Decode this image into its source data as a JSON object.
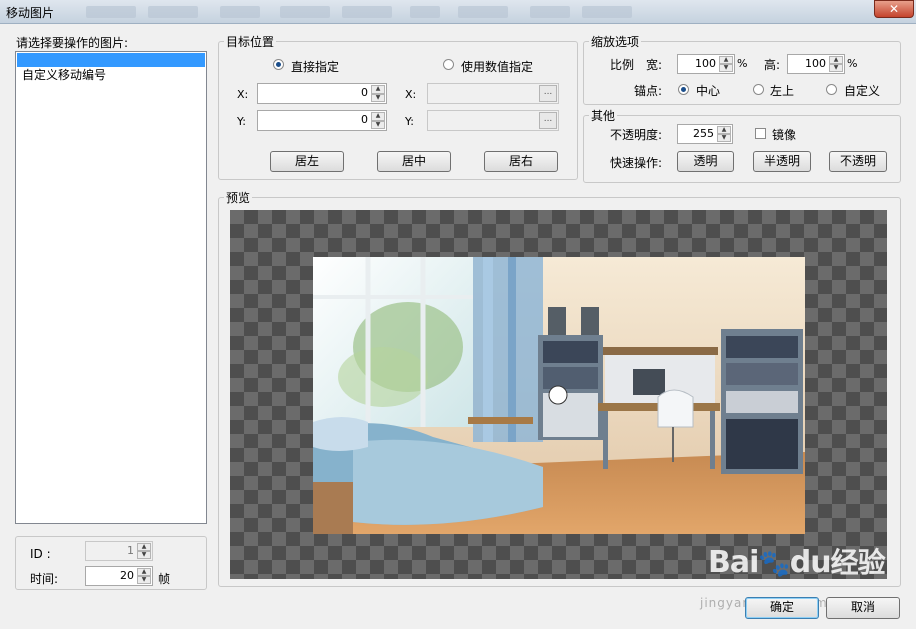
{
  "window": {
    "title": "移动图片",
    "close_glyph": "✕"
  },
  "picture_list": {
    "label": "请选择要操作的图片:",
    "items": [
      "",
      "自定义移动编号"
    ]
  },
  "id_time": {
    "id_label": "ID :",
    "id_value": "1",
    "time_label": "时间:",
    "time_value": "20",
    "time_unit": "帧"
  },
  "target": {
    "label": "目标位置",
    "direct_label": "直接指定",
    "numeric_label": "使用数值指定",
    "x_label": "X:",
    "y_label": "Y:",
    "x_value": "0",
    "y_value": "0",
    "browse_label": "...",
    "btn_left": "居左",
    "btn_center": "居中",
    "btn_right": "居右"
  },
  "scale": {
    "label": "缩放选项",
    "ratio_label": "比例",
    "width_label": "宽:",
    "width_value": "100",
    "pct": "%",
    "height_label": "高:",
    "height_value": "100",
    "anchor_label": "锚点:",
    "anchor_center": "中心",
    "anchor_topleft": "左上",
    "anchor_custom": "自定义"
  },
  "other": {
    "label": "其他",
    "opacity_label": "不透明度:",
    "opacity_value": "255",
    "mirror_label": "镜像",
    "quick_label": "快速操作:",
    "btn_transparent": "透明",
    "btn_semi": "半透明",
    "btn_opaque": "不透明"
  },
  "preview": {
    "label": "预览"
  },
  "footer": {
    "ok": "确定",
    "cancel": "取消"
  },
  "watermark": {
    "brand": "Bai",
    "brand2": "du",
    "brand3": "经验",
    "url": "jingyan.baidu.com"
  }
}
